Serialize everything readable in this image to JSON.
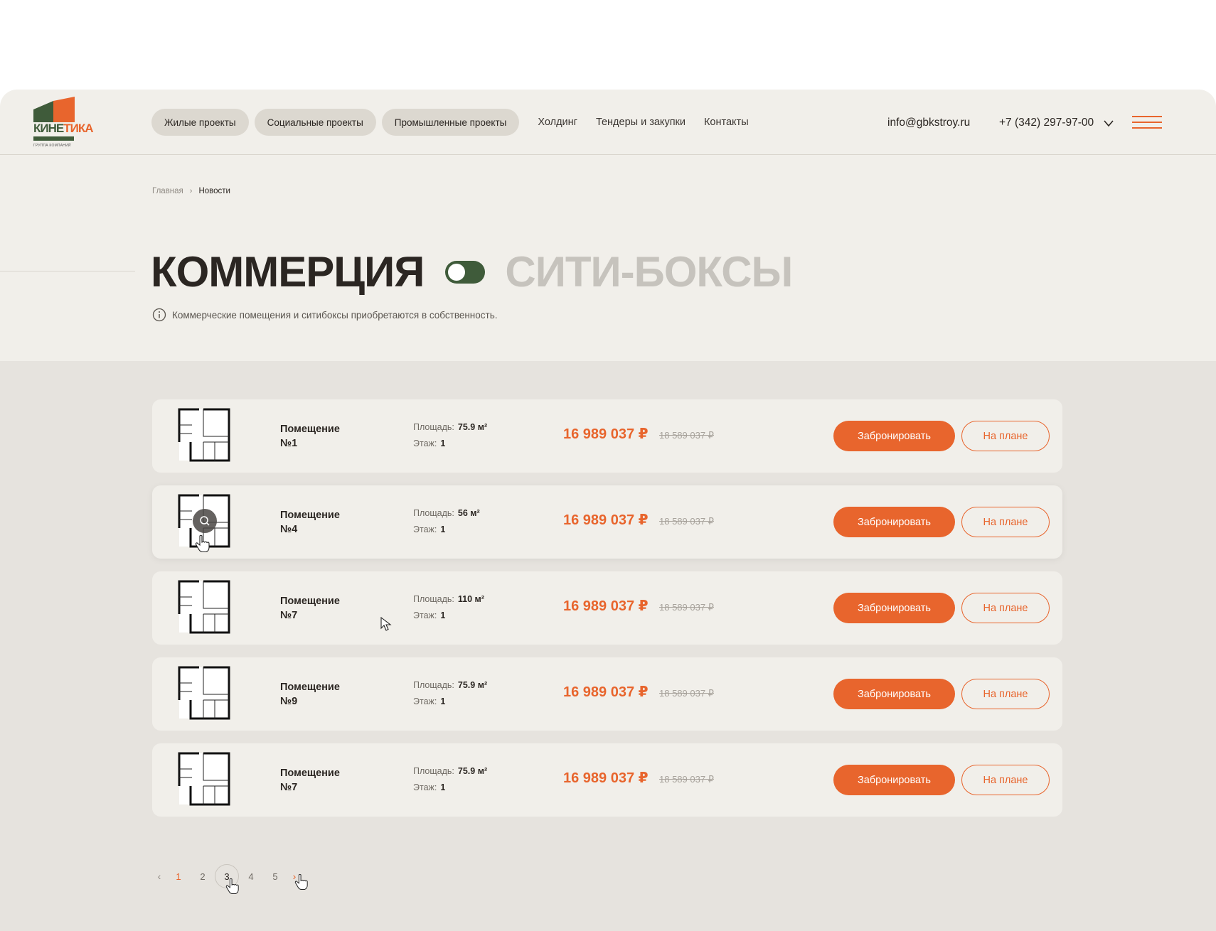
{
  "brand": {
    "logo_text_part1": "КИНЕ",
    "logo_text_part2": "ТИКА",
    "logo_sub": "ГРУППА КОМПАНИЙ",
    "primary_color": "#e8652d",
    "secondary_color": "#3f5b3a"
  },
  "header": {
    "pills": [
      "Жилые проекты",
      "Социальные проекты",
      "Промышленные проекты"
    ],
    "links": [
      "Холдинг",
      "Тендеры и закупки",
      "Контакты"
    ],
    "email": "info@gbkstroy.ru",
    "phone": "+7 (342) 297-97-00",
    "phone_dropdown_icon": "chevron-down-icon",
    "menu_icon": "hamburger-icon"
  },
  "breadcrumb": {
    "items": [
      "Главная",
      "Новости"
    ]
  },
  "page": {
    "title_active": "КОММЕРЦИЯ",
    "title_inactive": "СИТИ-БОКСЫ",
    "info": "Коммерческие помещения и ситибоксы приобретаются в собственность."
  },
  "labels": {
    "area": "Площадь:",
    "floor": "Этаж:",
    "book": "Забронировать",
    "on_plan": "На плане"
  },
  "rooms": [
    {
      "name": "Помещение №1",
      "area": "75.9 м²",
      "floor": "1",
      "price": "16 989 037 ₽",
      "old_price": "18 589 037 ₽"
    },
    {
      "name": "Помещение №4",
      "area": "56 м²",
      "floor": "1",
      "price": "16 989 037 ₽",
      "old_price": "18 589 037 ₽"
    },
    {
      "name": "Помещение №7",
      "area": "110 м²",
      "floor": "1",
      "price": "16 989 037 ₽",
      "old_price": "18 589 037 ₽"
    },
    {
      "name": "Помещение №9",
      "area": "75.9 м²",
      "floor": "1",
      "price": "16 989 037 ₽",
      "old_price": "18 589 037 ₽"
    },
    {
      "name": "Помещение №7",
      "area": "75.9 м²",
      "floor": "1",
      "price": "16 989 037 ₽",
      "old_price": "18 589 037 ₽"
    }
  ],
  "pagination": {
    "prev": "‹",
    "pages": [
      "1",
      "2",
      "3",
      "4",
      "5"
    ],
    "active": "3",
    "next": "›"
  }
}
